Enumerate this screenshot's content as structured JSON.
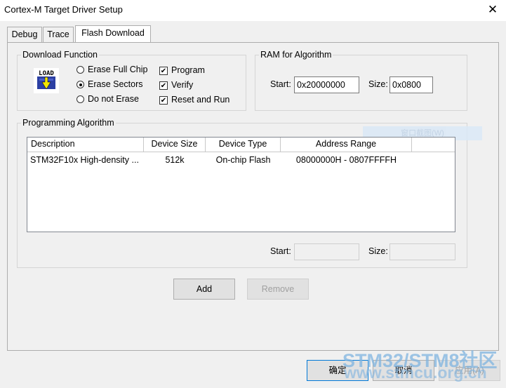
{
  "window": {
    "title": "Cortex-M Target Driver Setup",
    "close_glyph": "✕"
  },
  "tabs": [
    {
      "label": "Debug"
    },
    {
      "label": "Trace"
    },
    {
      "label": "Flash Download"
    }
  ],
  "download_function": {
    "legend": "Download Function",
    "icon_text": "LOAD",
    "radios": [
      {
        "label": "Erase Full Chip",
        "selected": false
      },
      {
        "label": "Erase Sectors",
        "selected": true
      },
      {
        "label": "Do not Erase",
        "selected": false
      }
    ],
    "checks": [
      {
        "label": "Program",
        "checked": true
      },
      {
        "label": "Verify",
        "checked": true
      },
      {
        "label": "Reset and Run",
        "checked": true
      }
    ]
  },
  "ram": {
    "legend": "RAM for Algorithm",
    "start_label": "Start:",
    "start_value": "0x20000000",
    "size_label": "Size:",
    "size_value": "0x0800"
  },
  "programming": {
    "legend": "Programming Algorithm",
    "columns": [
      "Description",
      "Device Size",
      "Device Type",
      "Address Range"
    ],
    "rows": [
      [
        "STM32F10x High-density ...",
        "512k",
        "On-chip Flash",
        "08000000H - 0807FFFFH"
      ]
    ],
    "start_label": "Start:",
    "start_value": "",
    "size_label": "Size:",
    "size_value": "",
    "ghost_text": "窗口截图(W)"
  },
  "buttons": {
    "add": "Add",
    "remove": "Remove",
    "ok": "确定",
    "cancel": "取消",
    "apply": "应用(A)"
  },
  "watermark": {
    "line1": "STM32/STM8社区",
    "line2": "www.stmcu.org.cn"
  }
}
